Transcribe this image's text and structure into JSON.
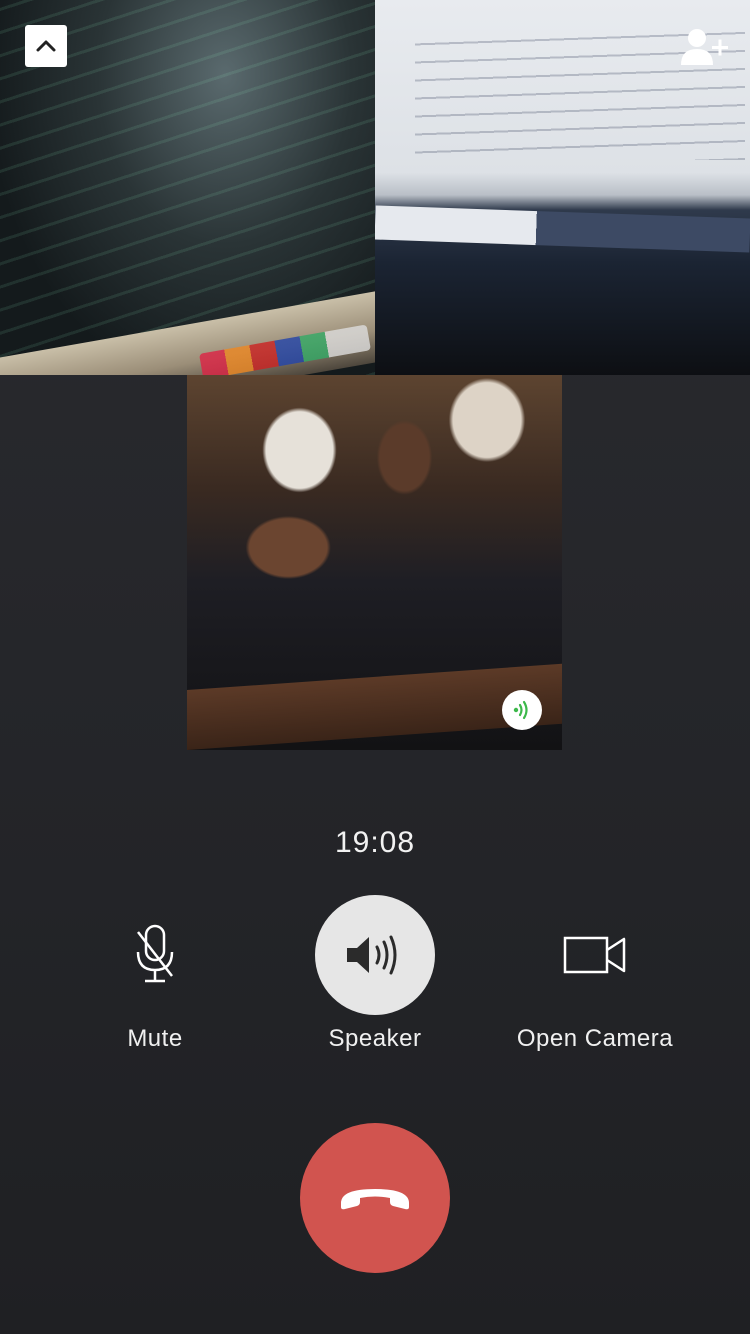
{
  "call": {
    "timer": "19:08"
  },
  "top_bar": {
    "minimize_icon": "chevron-up-icon",
    "add_member_icon": "add-person-icon"
  },
  "participants": [
    {
      "tile": "video-tile-1",
      "content": "laptop-code-screen"
    },
    {
      "tile": "video-tile-2",
      "content": "monitor-code-screen"
    },
    {
      "tile": "video-tile-3",
      "content": "photo",
      "speaking": true,
      "speaking_icon": "sound-waves-icon"
    }
  ],
  "controls": {
    "mute": {
      "label": "Mute",
      "icon": "microphone-muted-icon"
    },
    "speaker": {
      "label": "Speaker",
      "icon": "speaker-icon",
      "active": true
    },
    "camera": {
      "label": "Open Camera",
      "icon": "video-camera-icon"
    },
    "hangup": {
      "icon": "phone-hangup-icon"
    }
  },
  "colors": {
    "background": "#26272b",
    "hangup": "#d1544f",
    "active_control": "#e6e6e6",
    "speaking_indicator": "#3cb84a"
  }
}
